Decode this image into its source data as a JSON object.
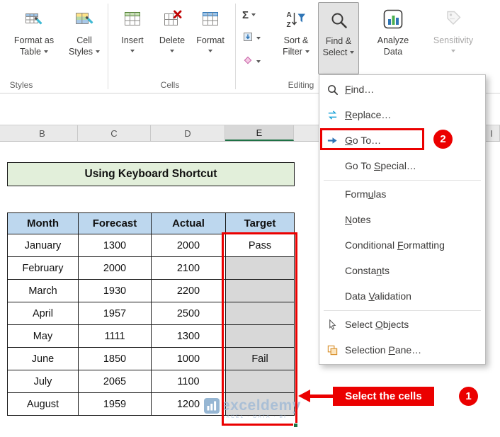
{
  "ribbon": {
    "buttons": [
      {
        "id": "format-as-table",
        "line1": "Format as",
        "line2": "Table"
      },
      {
        "id": "cell-styles",
        "line1": "Cell",
        "line2": "Styles"
      },
      {
        "id": "insert",
        "line1": "Insert"
      },
      {
        "id": "delete",
        "line1": "Delete"
      },
      {
        "id": "format",
        "line1": "Format"
      },
      {
        "id": "sort-filter",
        "line1": "Sort &",
        "line2": "Filter"
      },
      {
        "id": "find-select",
        "line1": "Find &",
        "line2": "Select"
      },
      {
        "id": "analyze-data",
        "line1": "Analyze",
        "line2": "Data"
      },
      {
        "id": "sensitivity",
        "line1": "Sensitivity"
      }
    ],
    "group_labels": [
      "Styles",
      "Cells",
      "Editing"
    ]
  },
  "menu": {
    "items": [
      {
        "id": "find",
        "icon": "find",
        "pre": "",
        "key": "F",
        "post": "ind…"
      },
      {
        "id": "replace",
        "icon": "replace",
        "pre": "",
        "key": "R",
        "post": "eplace…"
      },
      {
        "id": "go-to",
        "icon": "goto",
        "pre": "",
        "key": "G",
        "post": "o To…",
        "highlighted": true
      },
      {
        "id": "go-to-special",
        "pre": "Go To ",
        "key": "S",
        "post": "pecial…"
      },
      {
        "separator": true
      },
      {
        "id": "formulas",
        "pre": "Form",
        "key": "u",
        "post": "las"
      },
      {
        "id": "notes",
        "pre": "",
        "key": "N",
        "post": "otes"
      },
      {
        "id": "conditional-formatting",
        "pre": "Conditional ",
        "key": "F",
        "post": "ormatting"
      },
      {
        "id": "constants",
        "pre": "Consta",
        "key": "n",
        "post": "ts"
      },
      {
        "id": "data-validation",
        "pre": "Data ",
        "key": "V",
        "post": "alidation"
      },
      {
        "separator": true
      },
      {
        "id": "select-objects",
        "icon": "cursor",
        "pre": "Select ",
        "key": "O",
        "post": "bjects"
      },
      {
        "id": "selection-pane",
        "icon": "pane",
        "pre": "Selection ",
        "key": "P",
        "post": "ane…"
      }
    ]
  },
  "sheet": {
    "columns": [
      {
        "label": "B"
      },
      {
        "label": "C"
      },
      {
        "label": "D"
      },
      {
        "label": "E",
        "selected": true
      },
      {
        "label": "I"
      }
    ],
    "title": "Using Keyboard Shortcut"
  },
  "table": {
    "headers": [
      "Month",
      "Forecast",
      "Actual",
      "Target"
    ],
    "rows": [
      [
        "January",
        "1300",
        "2000",
        "Pass"
      ],
      [
        "February",
        "2000",
        "2100",
        ""
      ],
      [
        "March",
        "1930",
        "2200",
        ""
      ],
      [
        "April",
        "1957",
        "2500",
        ""
      ],
      [
        "May",
        "1111",
        "1300",
        ""
      ],
      [
        "June",
        "1850",
        "1000",
        "Fail"
      ],
      [
        "July",
        "2065",
        "1100",
        ""
      ],
      [
        "August",
        "1959",
        "1200",
        ""
      ]
    ]
  },
  "annotations": {
    "callout": "Select the cells",
    "step1": "1",
    "step2": "2"
  },
  "watermark": {
    "brand": "exceldemy",
    "tagline": "EXCEL · DATA · BI"
  },
  "colors": {
    "annotation_red": "#EB0000",
    "excel_green": "#1E7145",
    "table_header_blue": "#BDD7EE",
    "title_green": "#E2EFDA",
    "selected_cell_gray": "#D8D8D8",
    "watermark_blue": "#9FB9D6"
  }
}
